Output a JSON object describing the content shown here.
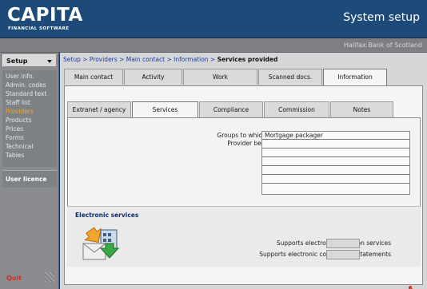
{
  "header": {
    "logo": "CAPITA",
    "logo_sub": "FINANCIAL SOFTWARE",
    "title": "System setup"
  },
  "subheader": {
    "bank": "Halifax Bank of Scotland"
  },
  "sidebar": {
    "section": "Setup",
    "items": [
      {
        "label": "User info.",
        "active": false
      },
      {
        "label": "Admin. codes",
        "active": false
      },
      {
        "label": "Standard text",
        "active": false
      },
      {
        "label": "Staff list",
        "active": false
      },
      {
        "label": "Providers",
        "active": true
      },
      {
        "label": "Products",
        "active": false
      },
      {
        "label": "Prices",
        "active": false
      },
      {
        "label": "Forms",
        "active": false
      },
      {
        "label": "Technical",
        "active": false
      },
      {
        "label": "Tables",
        "active": false
      }
    ],
    "licence": "User licence",
    "quit": "Quit"
  },
  "breadcrumb": {
    "path": "Setup > Providers > Main contact > Information > ",
    "current": "Services provided"
  },
  "tabs_top": [
    {
      "label": "Main contact",
      "active": false
    },
    {
      "label": "Activity",
      "active": false
    },
    {
      "label": "Work",
      "active": false
    },
    {
      "label": "Scanned docs.",
      "active": false
    },
    {
      "label": "Information",
      "active": true
    }
  ],
  "tabs_sub": [
    {
      "label": "Extranet / agency",
      "active": false
    },
    {
      "label": "Services",
      "active": true
    },
    {
      "label": "Compliance",
      "active": false
    },
    {
      "label": "Commission",
      "active": false
    },
    {
      "label": "Notes",
      "active": false
    }
  ],
  "services": {
    "groups_label_line1": "Groups to which the",
    "groups_label_line2": "Provider belongs",
    "groups": [
      "Mortgage packager",
      "",
      "",
      "",
      "",
      "",
      ""
    ]
  },
  "electronic": {
    "title": "Electronic services",
    "valuation_label": "Supports electronic valuation services",
    "commission_label": "Supports electronic commission statements"
  },
  "colors": {
    "header": "#1d4a78",
    "sidebar": "#8a8c8f",
    "active_item": "#f2a531",
    "quit": "#d52b1e",
    "link": "#1a3aa0"
  }
}
